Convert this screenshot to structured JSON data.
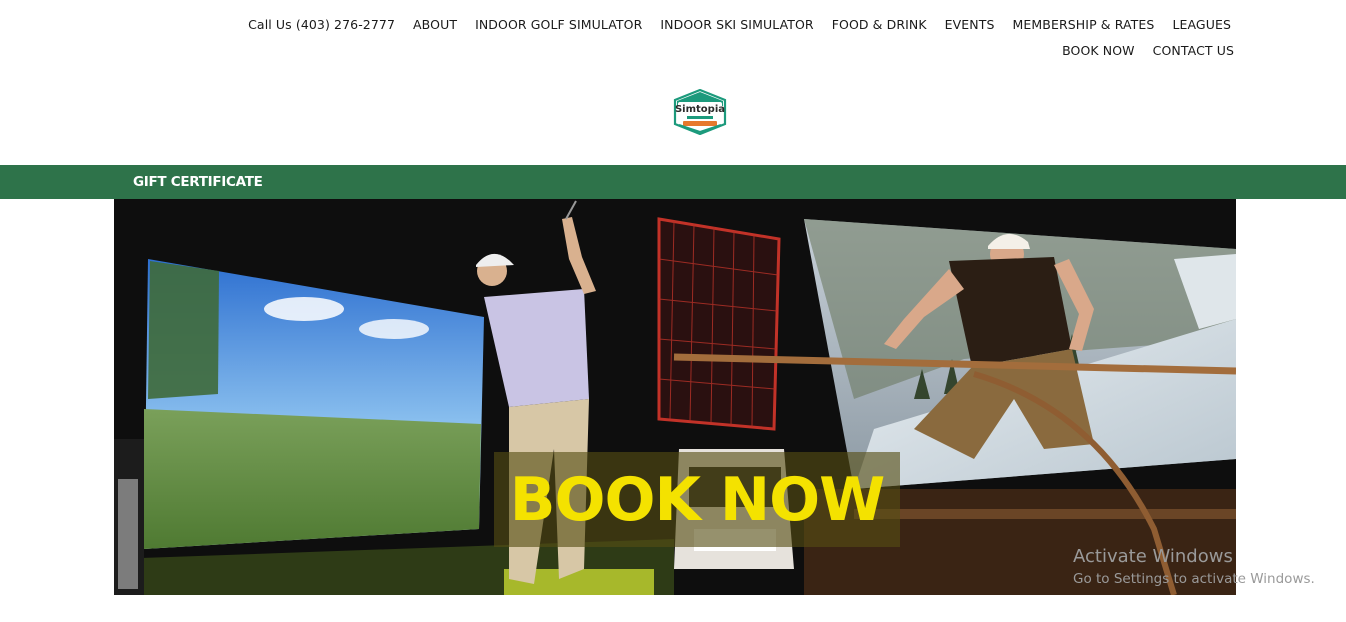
{
  "nav": {
    "items": [
      {
        "label": "Call Us (403) 276-2777"
      },
      {
        "label": "ABOUT"
      },
      {
        "label": "INDOOR GOLF SIMULATOR"
      },
      {
        "label": "INDOOR SKI SIMULATOR"
      },
      {
        "label": "FOOD & DRINK"
      },
      {
        "label": "EVENTS"
      },
      {
        "label": "MEMBERSHIP & RATES"
      },
      {
        "label": "LEAGUES"
      },
      {
        "label": "BOOK NOW"
      },
      {
        "label": "CONTACT US"
      }
    ]
  },
  "logo": {
    "brand": "Simtopia",
    "icon": "simtopia-logo-icon"
  },
  "banner": {
    "gift_label": "GIFT CERTIFICATE"
  },
  "hero": {
    "book_now_label": "BOOK NOW"
  },
  "watermark": {
    "title": "Activate Windows",
    "subtitle": "Go to Settings to activate Windows."
  },
  "colors": {
    "green_bar": "#2e734a",
    "book_now_text": "#f4e200",
    "logo_teal": "#1c9a7c",
    "logo_orange": "#e7782c"
  }
}
